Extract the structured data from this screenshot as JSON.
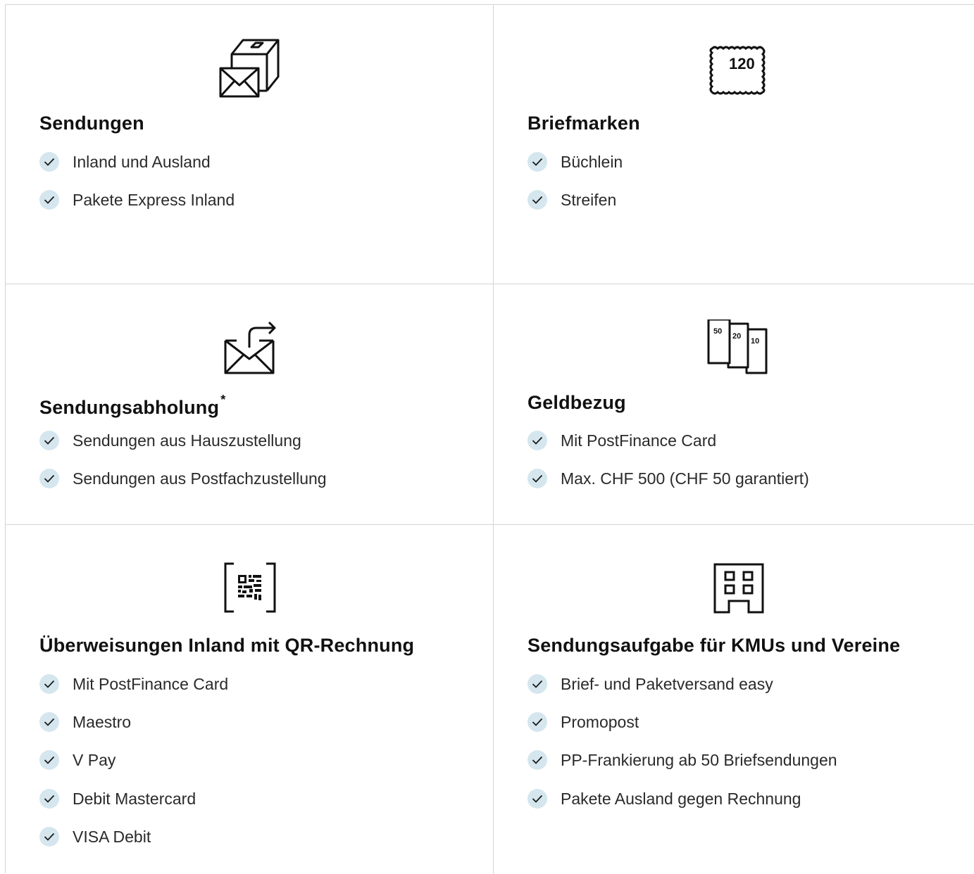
{
  "services": [
    {
      "id": "sendungen",
      "icon": "parcel-letter-icon",
      "title": "Sendungen",
      "asterisk": "",
      "items": [
        "Inland und Ausland",
        "Pakete Express Inland"
      ]
    },
    {
      "id": "briefmarken",
      "icon": "stamp-icon",
      "stamp_value": "120",
      "title": "Briefmarken",
      "asterisk": "",
      "items": [
        "Büchlein",
        "Streifen"
      ]
    },
    {
      "id": "sendungsabholung",
      "icon": "letter-pickup-icon",
      "title": "Sendungsabholung",
      "asterisk": "*",
      "items": [
        "Sendungen aus Hauszustellung",
        "Sendungen aus Postfachzustellung"
      ]
    },
    {
      "id": "geldbezug",
      "icon": "banknotes-icon",
      "banknote_values": [
        "50",
        "20",
        "10"
      ],
      "title": "Geldbezug",
      "asterisk": "",
      "items": [
        "Mit PostFinance Card",
        "Max. CHF 500 (CHF 50 garantiert)"
      ]
    },
    {
      "id": "ueberweisungen",
      "icon": "qr-code-icon",
      "title": "Überweisungen Inland mit QR-Rechnung",
      "asterisk": "",
      "items": [
        "Mit PostFinance Card",
        "Maestro",
        "V Pay",
        "Debit Mastercard",
        "VISA Debit"
      ]
    },
    {
      "id": "sendungsaufgabe",
      "icon": "building-icon",
      "title": "Sendungsaufgabe für KMUs und Vereine",
      "asterisk": "",
      "items": [
        "Brief- und Paketversand easy",
        "Promopost",
        "PP-Frankierung ab 50 Briefsendungen",
        "Pakete Ausland gegen Rechnung"
      ]
    }
  ],
  "colors": {
    "check_bg": "#d5e6ee",
    "divider": "#d4d4d4",
    "text": "#1a1a1a"
  }
}
